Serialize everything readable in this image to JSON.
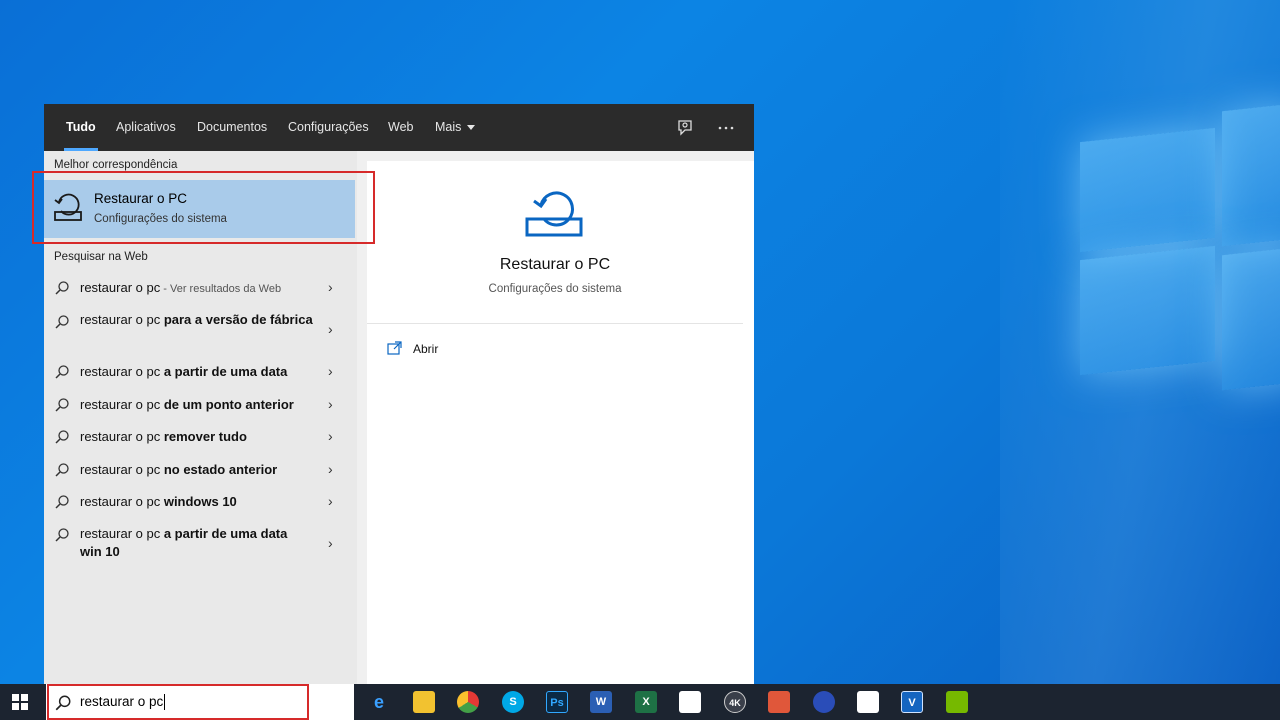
{
  "tabs": [
    {
      "label": "Tudo",
      "active": true
    },
    {
      "label": "Aplicativos"
    },
    {
      "label": "Documentos"
    },
    {
      "label": "Configurações"
    },
    {
      "label": "Web"
    },
    {
      "label": "Mais"
    }
  ],
  "best_match": {
    "section_label": "Melhor correspondência",
    "title": "Restaurar o PC",
    "subtitle": "Configurações do sistema",
    "icon": "restore-pc-icon"
  },
  "web": {
    "section_label": "Pesquisar na Web",
    "results": [
      {
        "prefix": "restaurar o pc",
        "bold": "",
        "hint": " - Ver resultados da Web"
      },
      {
        "prefix": "restaurar o pc ",
        "bold": "para a versão de fábrica",
        "hint": ""
      },
      {
        "prefix": "restaurar o pc ",
        "bold": "a partir de uma data",
        "hint": ""
      },
      {
        "prefix": "restaurar o pc ",
        "bold": "de um ponto anterior",
        "hint": ""
      },
      {
        "prefix": "restaurar o pc ",
        "bold": "remover tudo",
        "hint": ""
      },
      {
        "prefix": "restaurar o pc ",
        "bold": "no estado anterior",
        "hint": ""
      },
      {
        "prefix": "restaurar o pc ",
        "bold": "windows 10",
        "hint": ""
      },
      {
        "prefix": "restaurar o pc ",
        "bold": "a partir de uma data win 10",
        "hint": ""
      }
    ]
  },
  "preview": {
    "title": "Restaurar o PC",
    "subtitle": "Configurações do sistema",
    "open_label": "Abrir"
  },
  "taskbar": {
    "search_value": "restaurar o pc",
    "apps": [
      "edge-icon",
      "file-explorer-icon",
      "chrome-icon",
      "skype-icon",
      "photoshop-icon",
      "word-icon",
      "excel-icon",
      "mail-icon",
      "4k-downloader-icon",
      "app-icon",
      "app-icon",
      "calendar-icon",
      "vegas-icon",
      "nvidia-icon"
    ]
  },
  "colors": {
    "accent": "#4ea8ff",
    "selection": "#a9cbea",
    "highlight_box": "#d62a2a",
    "icon_blue": "#0a66c2"
  }
}
